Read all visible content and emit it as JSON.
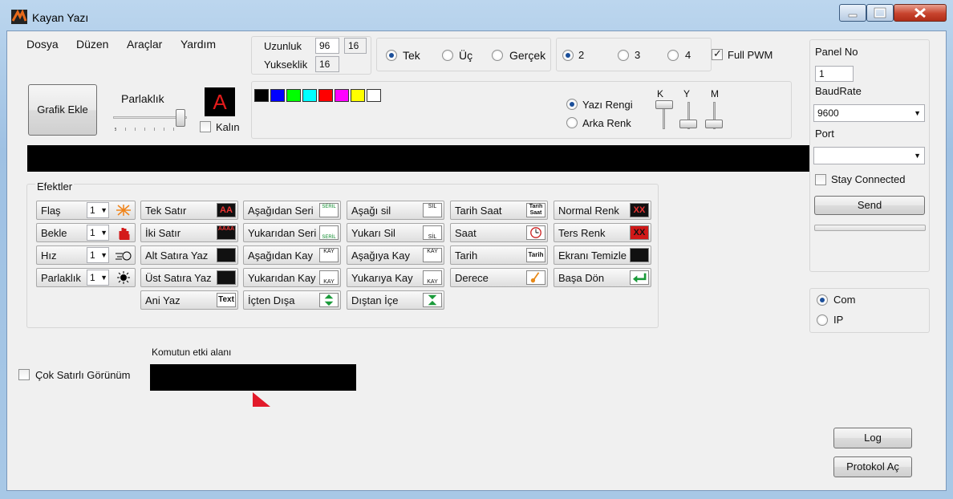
{
  "window": {
    "title": "Kayan Yazı"
  },
  "menu": [
    "Dosya",
    "Düzen",
    "Araçlar",
    "Yardım"
  ],
  "size": {
    "width_label": "Uzunluk",
    "width_value": "96",
    "width_value2": "16",
    "height_label": "Yukseklik",
    "height_value": "16"
  },
  "mode_radios": {
    "tek": "Tek",
    "uc": "Üç",
    "gercek": "Gerçek",
    "selected": "tek"
  },
  "pwm_radios": {
    "two": "2",
    "three": "3",
    "four": "4",
    "selected": "two"
  },
  "full_pwm": {
    "label": "Full PWM",
    "checked": true
  },
  "graphic_button": "Grafik Ekle",
  "brightness": {
    "label": "Parlaklık"
  },
  "font_preview": {
    "letter": "A",
    "color": "#e31b1b"
  },
  "bold": {
    "label": "Kalın",
    "checked": false
  },
  "palette": [
    "#000000",
    "#0000ff",
    "#00ff00",
    "#00ffff",
    "#ff0000",
    "#ff00ff",
    "#ffff00",
    "#ffffff"
  ],
  "color_target": {
    "text": "Yazı Rengi",
    "background": "Arka Renk",
    "selected": "text"
  },
  "rgb_sliders": {
    "r": "K",
    "g": "Y",
    "b": "M"
  },
  "effects": {
    "title": "Efektler",
    "col1": [
      {
        "label": "Flaş",
        "value": "1",
        "icon": "flash-icon"
      },
      {
        "label": "Bekle",
        "value": "1",
        "icon": "hand-stop-icon"
      },
      {
        "label": "Hız",
        "value": "1",
        "icon": "speed-icon"
      },
      {
        "label": "Parlaklık",
        "value": "1",
        "icon": "brightness-icon"
      }
    ],
    "col2": [
      {
        "label": "Tek Satır",
        "icon_text": "AA",
        "icon": "single-line-icon"
      },
      {
        "label": "İki Satır",
        "icon_text": "AAAA",
        "icon": "two-line-icon"
      },
      {
        "label": "Alt Satıra Yaz",
        "icon_text": "",
        "icon": "lower-line-icon"
      },
      {
        "label": "Üst Satıra Yaz",
        "icon_text": "",
        "icon": "upper-line-icon"
      },
      {
        "label": "Ani Yaz",
        "icon_text": "Text",
        "icon": "instant-text-icon"
      }
    ],
    "col3": [
      {
        "label": "Aşağıdan Seri",
        "icon_text": "SERİL",
        "icon": "serial-up-icon"
      },
      {
        "label": "Yukarıdan Seri",
        "icon_text": "SERİL",
        "icon": "serial-down-icon"
      },
      {
        "label": "Aşağıdan Kay",
        "icon_text": "KAY",
        "icon": "scroll-up-icon"
      },
      {
        "label": "Yukarıdan Kay",
        "icon_text": "KAY",
        "icon": "scroll-down-icon"
      },
      {
        "label": "İçten Dışa",
        "icon_text": "",
        "icon": "inside-out-icon"
      }
    ],
    "col4": [
      {
        "label": "Aşağı sil",
        "icon_text": "SİL",
        "icon": "erase-down-icon"
      },
      {
        "label": "Yukarı Sil",
        "icon_text": "SİL",
        "icon": "erase-up-icon"
      },
      {
        "label": "Aşağıya Kay",
        "icon_text": "KAY",
        "icon": "scroll-downward-icon"
      },
      {
        "label": "Yukarıya Kay",
        "icon_text": "KAY",
        "icon": "scroll-upward-icon"
      },
      {
        "label": "Dıştan İçe",
        "icon_text": "",
        "icon": "outside-in-icon"
      }
    ],
    "col5": [
      {
        "label": "Tarih Saat",
        "icon_text": "Tarih Saat",
        "icon": "date-time-icon"
      },
      {
        "label": "Saat",
        "icon_text": "",
        "icon": "clock-icon"
      },
      {
        "label": "Tarih",
        "icon_text": "Tarih",
        "icon": "date-icon"
      },
      {
        "label": "Derece",
        "icon_text": "",
        "icon": "thermometer-icon"
      }
    ],
    "col6": [
      {
        "label": "Normal Renk",
        "icon_text": "XX",
        "icon": "normal-color-icon"
      },
      {
        "label": "Ters Renk",
        "icon_text": "XX",
        "icon": "invert-color-icon"
      },
      {
        "label": "Ekranı Temizle",
        "icon_text": "",
        "icon": "clear-screen-icon"
      },
      {
        "label": "Başa Dön",
        "icon_text": "",
        "icon": "return-icon"
      }
    ]
  },
  "multiline": {
    "label": "Çok Satırlı Görünüm",
    "checked": false
  },
  "command_area": {
    "label": "Komutun etki alanı"
  },
  "right_panel": {
    "panel_no_label": "Panel No",
    "panel_no_value": "1",
    "baud_label": "BaudRate",
    "baud_value": "9600",
    "port_label": "Port",
    "port_value": "",
    "stay_connected": "Stay Connected",
    "send": "Send",
    "conn_com": "Com",
    "conn_ip": "IP",
    "conn_selected": "com",
    "log": "Log",
    "protocol": "Protokol Aç"
  }
}
